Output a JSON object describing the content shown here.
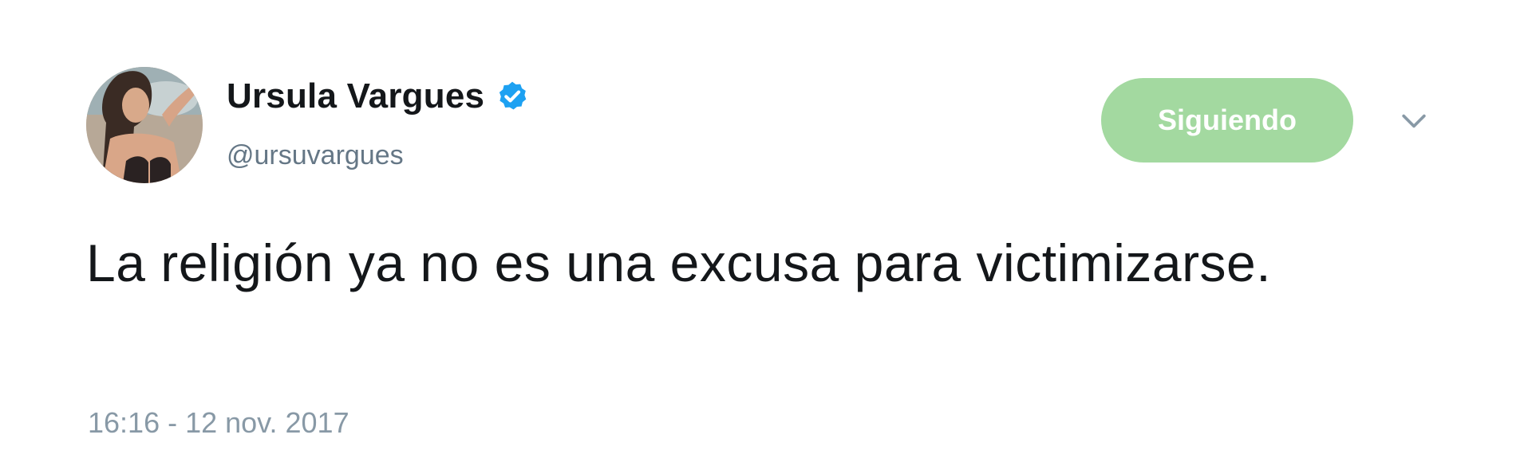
{
  "user": {
    "display_name": "Ursula Vargues",
    "handle": "@ursuvargues",
    "verified": true
  },
  "follow_button": {
    "label": "Siguiendo"
  },
  "tweet": {
    "text": "La religión ya no es una excusa para victimizarse.",
    "timestamp": "16:16 - 12 nov. 2017"
  },
  "icons": {
    "verified": "verified-badge-icon",
    "more": "chevron-down-icon"
  },
  "colors": {
    "verified_blue": "#1da1f2",
    "follow_green": "#a3d9a0",
    "secondary_text": "#657786"
  }
}
